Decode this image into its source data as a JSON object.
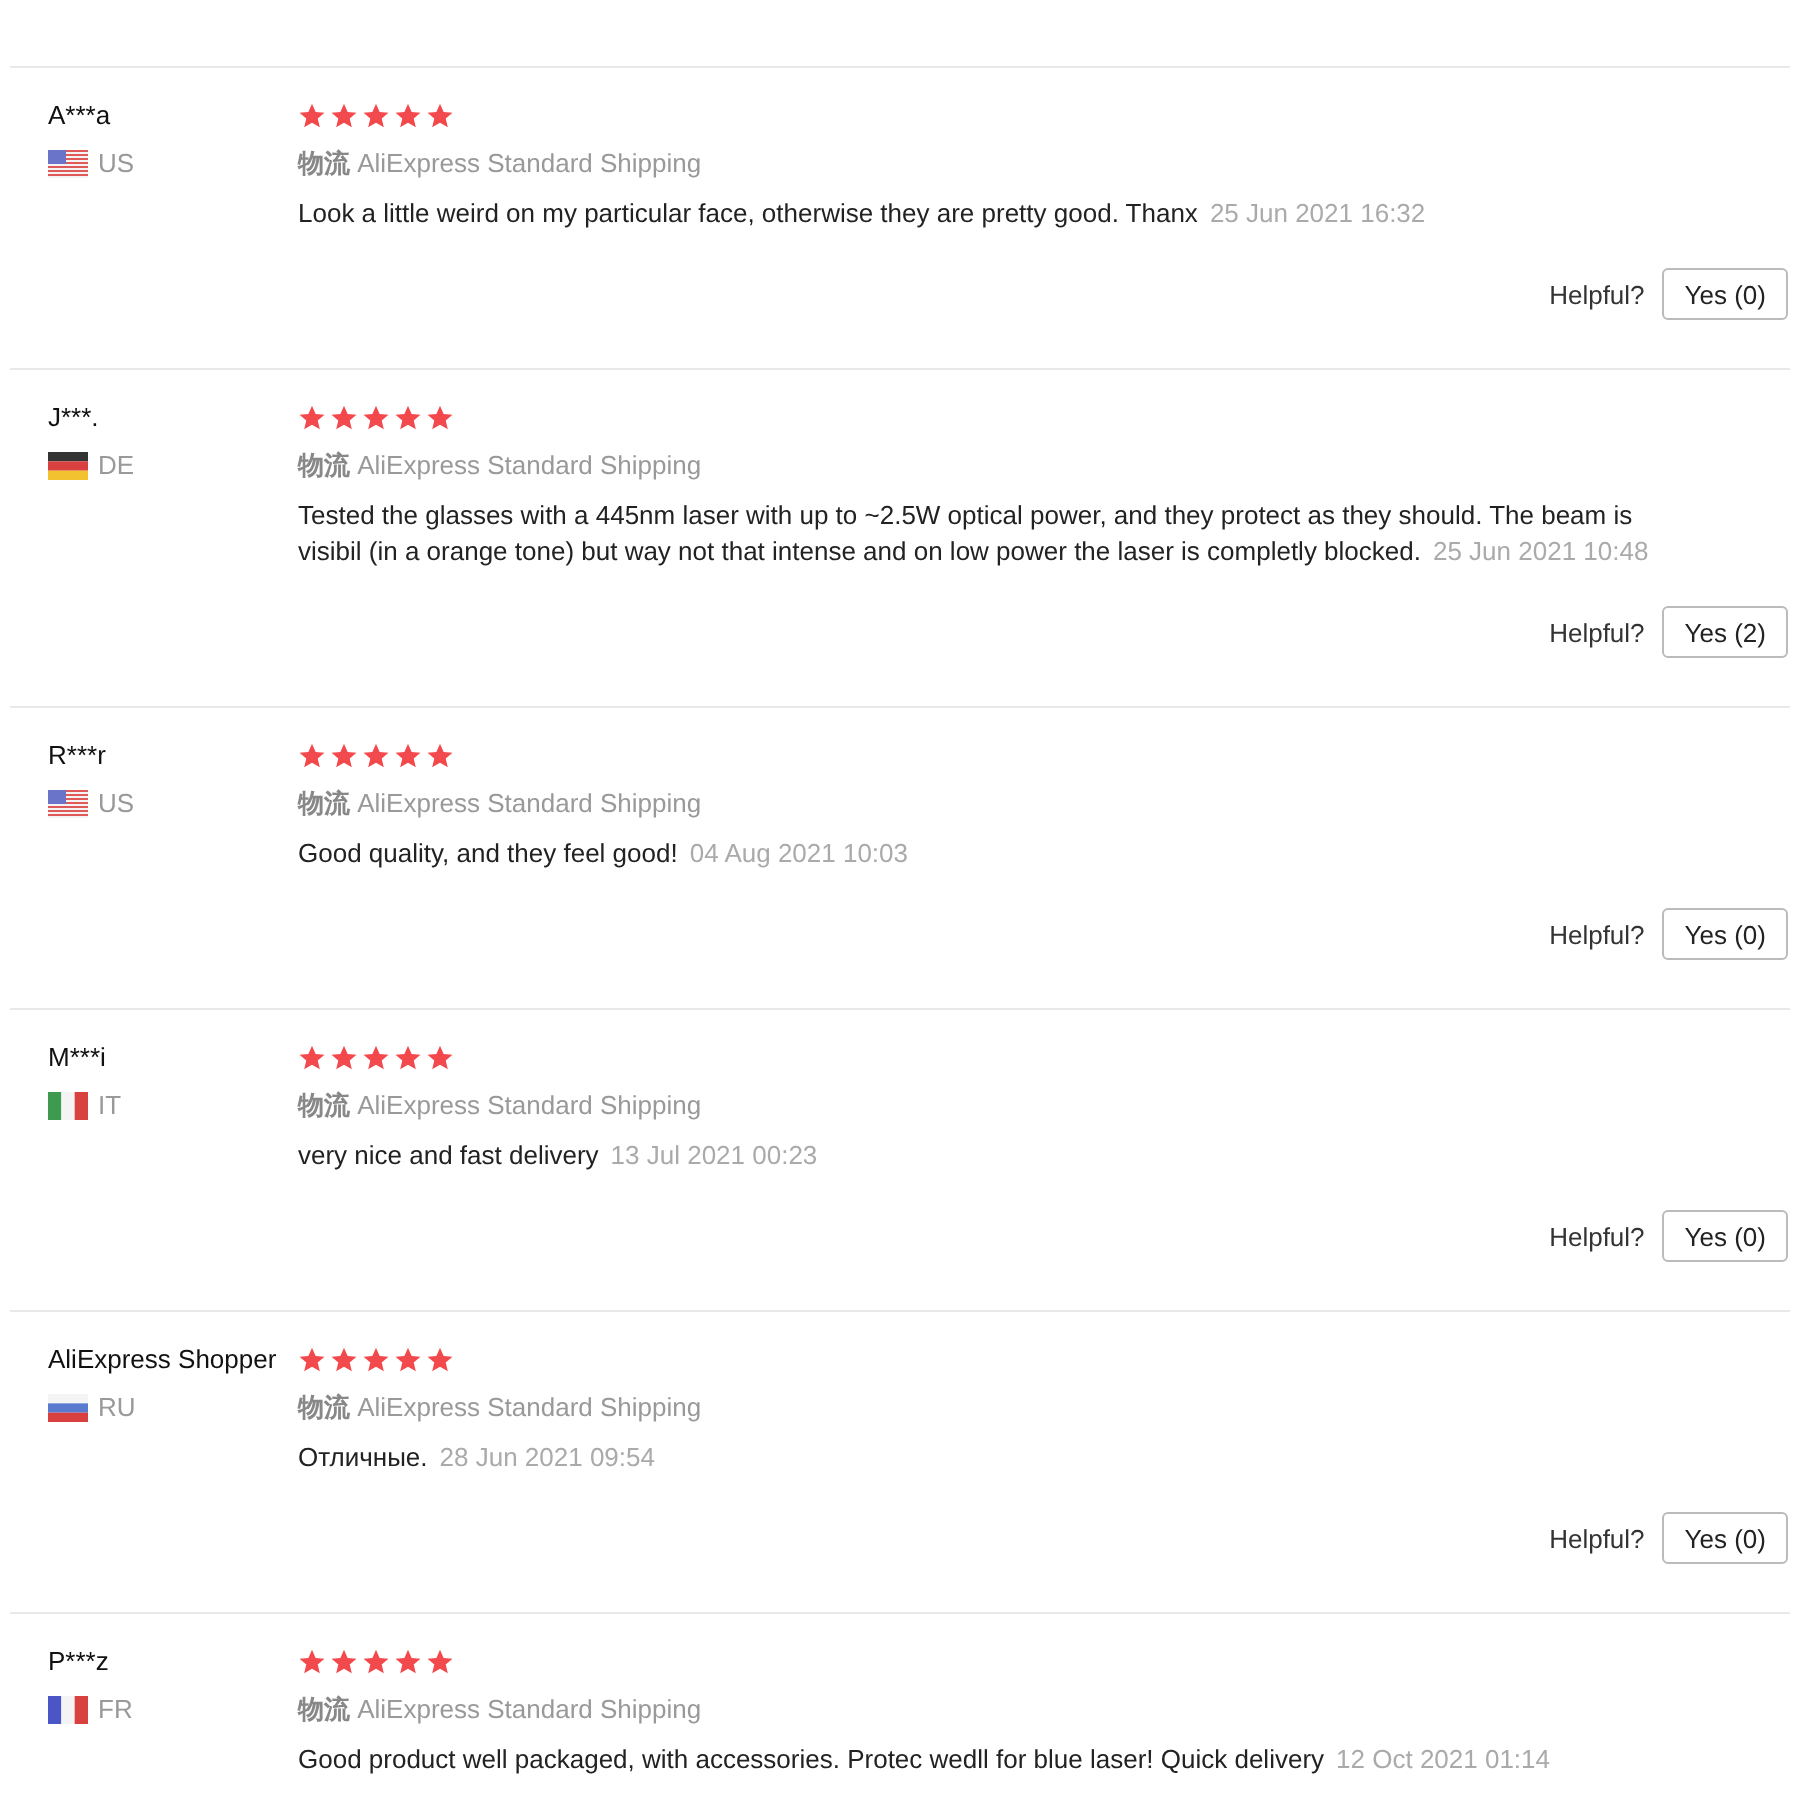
{
  "reviews": [
    {
      "name": "A***a",
      "flag": {
        "kind": "us"
      },
      "country": "US",
      "stars": 5,
      "shipping": "**物流** AliExpress Standard Shipping",
      "comment": "Look a little weird on my particular face, otherwise they are pretty good. Thanx",
      "date": "25 Jun 2021 16:32",
      "helpful_label": "Helpful?",
      "helpful_button": "Yes (0)"
    },
    {
      "name": "J***.",
      "flag": {
        "kind": "de"
      },
      "country": "DE",
      "stars": 5,
      "shipping": "**物流** AliExpress Standard Shipping",
      "comment": "Tested the glasses with a 445nm laser with up to ~2.5W optical power, and they protect as they should. The beam is visibil (in a orange tone) but way not that intense and on low power the laser is completly blocked.",
      "date": "25 Jun 2021 10:48",
      "helpful_label": "Helpful?",
      "helpful_button": "Yes (2)"
    },
    {
      "name": "R***r",
      "flag": {
        "kind": "us"
      },
      "country": "US",
      "stars": 5,
      "shipping": "**物流** AliExpress Standard Shipping",
      "comment": "Good quality, and they feel good!",
      "date": "04 Aug 2021 10:03",
      "helpful_label": "Helpful?",
      "helpful_button": "Yes (0)"
    },
    {
      "name": "M***i",
      "flag": {
        "kind": "it"
      },
      "country": "IT",
      "stars": 5,
      "shipping": "**物流** AliExpress Standard Shipping",
      "comment": "very nice and fast delivery",
      "date": "13 Jul 2021 00:23",
      "helpful_label": "Helpful?",
      "helpful_button": "Yes (0)"
    },
    {
      "name": "AliExpress Shopper",
      "flag": {
        "kind": "ru"
      },
      "country": "RU",
      "stars": 5,
      "shipping": "**物流** AliExpress Standard Shipping",
      "comment": "Отличные.",
      "date": "28 Jun 2021 09:54",
      "helpful_label": "Helpful?",
      "helpful_button": "Yes (0)"
    },
    {
      "name": "P***z",
      "flag": {
        "kind": "fr"
      },
      "country": "FR",
      "stars": 5,
      "shipping": "**物流** AliExpress Standard Shipping",
      "comment": "Good product well packaged, with accessories. Protec wedll for blue laser! Quick delivery",
      "date": "12 Oct 2021 01:14"
    }
  ]
}
